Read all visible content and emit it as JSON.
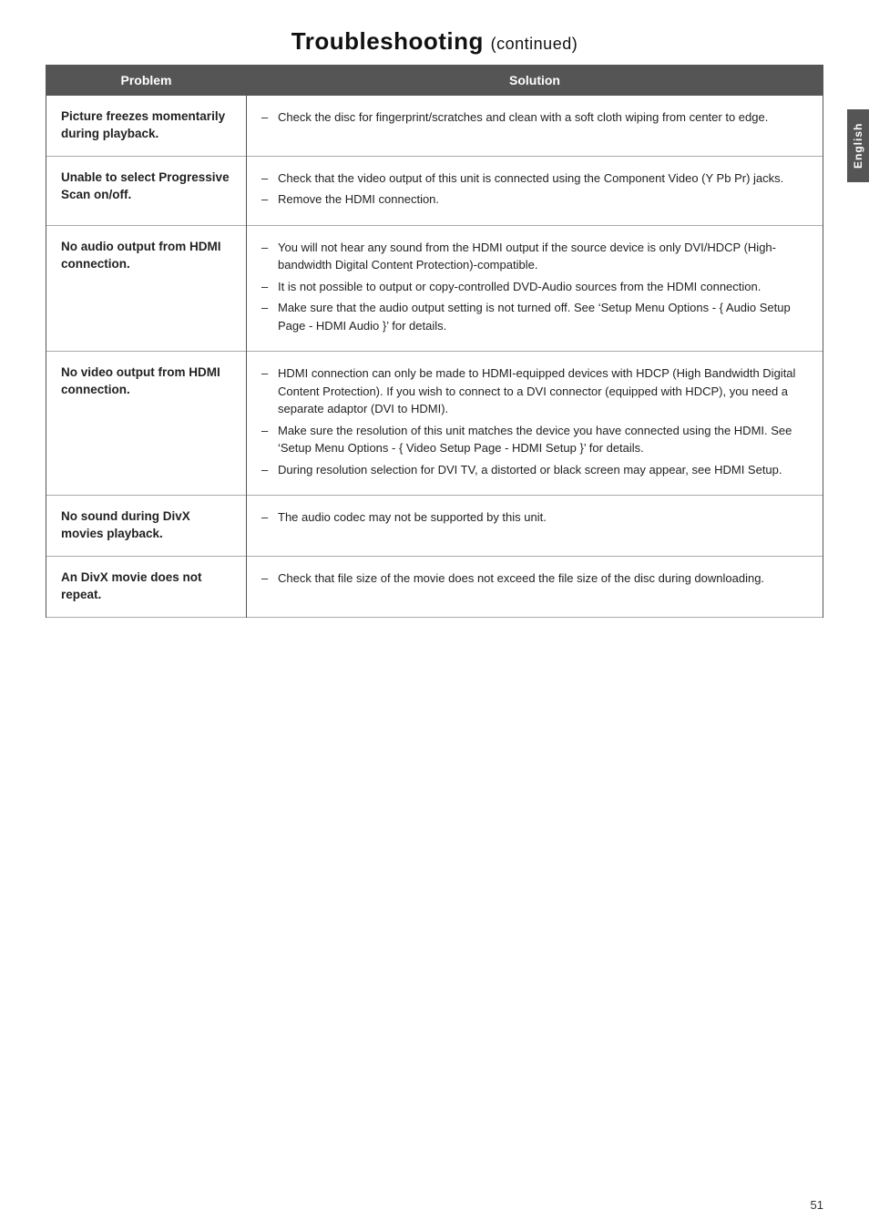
{
  "page": {
    "title": "Troubleshooting",
    "title_suffix": "(continued)",
    "side_tab_label": "English",
    "page_number": "51"
  },
  "table": {
    "header": {
      "problem": "Problem",
      "solution": "Solution"
    },
    "rows": [
      {
        "problem": "Picture freezes momentarily during playback.",
        "solutions": [
          "Check the disc for fingerprint/scratches and clean with a soft cloth wiping from center to edge."
        ]
      },
      {
        "problem": "Unable to select Progressive Scan on/off.",
        "solutions": [
          "Check that the video output of this unit is connected using the Component Video (Y Pb Pr) jacks.",
          "Remove the HDMI connection."
        ]
      },
      {
        "problem": "No audio output from HDMI connection.",
        "solutions": [
          "You will not hear any sound from the HDMI output if the source device is only DVI/HDCP (High-bandwidth Digital Content Protection)-compatible.",
          "It is not possible to output or copy-controlled DVD-Audio sources from the HDMI connection.",
          "Make sure that the audio output setting is not turned off. See ‘Setup Menu Options - { Audio Setup Page - HDMI Audio }’ for details."
        ]
      },
      {
        "problem": "No video output from HDMI connection.",
        "solutions": [
          "HDMI connection can only be made to HDMI-equipped devices with HDCP (High Bandwidth Digital Content Protection). If you wish to connect to a DVI connector (equipped with HDCP), you need a separate adaptor (DVI to HDMI).",
          "Make sure the resolution of this unit matches the device you have connected using the HDMI. See ‘Setup Menu Options - { Video Setup Page - HDMI Setup }’ for details.",
          "During resolution selection for DVI TV, a distorted or black screen may appear, see HDMI Setup."
        ]
      },
      {
        "problem": "No sound during DivX movies playback.",
        "solutions": [
          "The audio codec may not be supported by this unit."
        ]
      },
      {
        "problem": "An DivX movie does not repeat.",
        "solutions": [
          "Check that file size of the movie does not exceed the file size of the disc during downloading."
        ]
      }
    ]
  }
}
